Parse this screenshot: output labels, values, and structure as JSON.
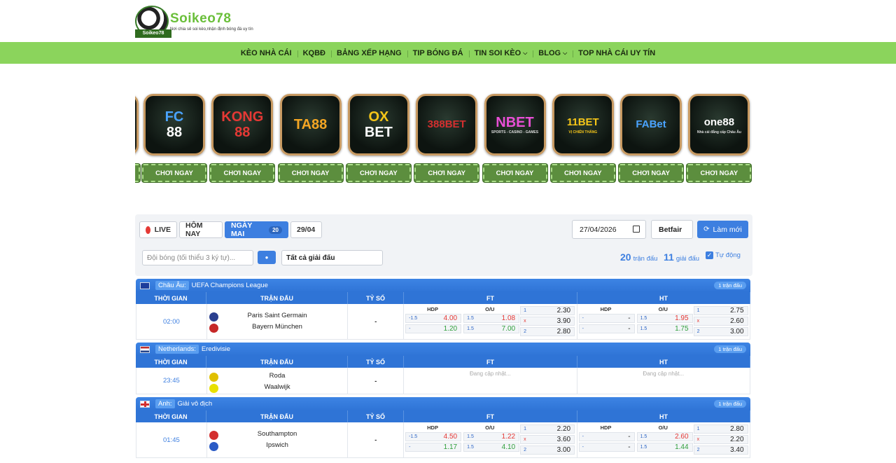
{
  "header": {
    "logo_name": "Soikeo78",
    "logo_slogan": "Nơi chia sẻ soi kèo,nhận định bóng đá uy tín",
    "logo_tag": "Soikeo78"
  },
  "nav": [
    {
      "label": "KÈO NHÀ CÁI",
      "dropdown": false
    },
    {
      "label": "KQBĐ",
      "dropdown": false
    },
    {
      "label": "BẢNG XẾP HẠNG",
      "dropdown": false
    },
    {
      "label": "TIP BÓNG ĐÁ",
      "dropdown": false
    },
    {
      "label": "TIN SOI KÈO",
      "dropdown": true
    },
    {
      "label": "BLOG",
      "dropdown": true
    },
    {
      "label": "TOP NHÀ CÁI UY TÍN",
      "dropdown": false
    }
  ],
  "casinos": [
    {
      "name": "FC88",
      "line1": "FC",
      "line2": "88",
      "color1": "#4aa3ff",
      "color2": "#ffffff"
    },
    {
      "name": "KONG88",
      "line1": "KONG",
      "line2": "88",
      "color1": "#e53935",
      "color2": "#e53935"
    },
    {
      "name": "TA88",
      "line1": "TA88",
      "line2": "",
      "color1": "#f5a623",
      "color2": "#f5a623"
    },
    {
      "name": "OXBET",
      "line1": "OX",
      "line2": "BET",
      "color1": "#f5c518",
      "color2": "#ffffff"
    },
    {
      "name": "388BET",
      "line1": "388BET",
      "line2": "",
      "color1": "#d32f2f",
      "color2": "#d32f2f"
    },
    {
      "name": "NBET",
      "line1": "NBET",
      "line2": "SPORTS - CASINO - GAMES",
      "color1": "#e94fd6",
      "color2": "#dddddd"
    },
    {
      "name": "11BET",
      "line1": "11BET",
      "line2": "VỊ CHIẾN THẮNG",
      "color1": "#f5c518",
      "color2": "#f5c518"
    },
    {
      "name": "FABET",
      "line1": "FABet",
      "line2": "",
      "color1": "#4aa3ff",
      "color2": "#4aa3ff"
    },
    {
      "name": "ONE88",
      "line1": "one88",
      "line2": "Nhà cái đẳng cấp Châu Âu",
      "color1": "#ffffff",
      "color2": "#dddddd"
    }
  ],
  "casino_button_label": "CHƠI NGAY",
  "filters": {
    "live": "LIVE",
    "today": "HÔM NAY",
    "tomorrow": "NGÀY MAI",
    "tomorrow_count": "20",
    "other_date": "29/04",
    "date_value": "27/04/2026",
    "provider": "Betfair",
    "refresh": "Làm mới",
    "search_placeholder": "Đội bóng (tối thiểu 3 ký tự)...",
    "league_select": "Tất cả giải đấu",
    "match_count": "20",
    "match_count_label": "trận đấu",
    "league_count": "11",
    "league_count_label": "giải đấu",
    "auto_label": "Tự động"
  },
  "columns": {
    "time": "THỜI GIAN",
    "match": "TRẬN ĐẤU",
    "score": "TỶ SỐ",
    "ft": "FT",
    "ht": "HT"
  },
  "odds_labels": {
    "hdp": "HDP",
    "ou": "O/U"
  },
  "pending_text": "Đang cập nhật...",
  "leagues": [
    {
      "country": "Châu Âu:",
      "name": "UEFA Champions League",
      "count": "1 trận đấu",
      "time": "02:00",
      "home": "Paris Saint Germain",
      "away": "Bayern München",
      "score": "-",
      "ft": {
        "hdp": [
          {
            "l": "-1.5",
            "v": "4.00"
          },
          {
            "l": "-",
            "v": "1.20"
          }
        ],
        "ou": [
          {
            "l": "1.5",
            "v": "1.08"
          },
          {
            "l": "1.5",
            "v": "7.00"
          }
        ],
        "x12": [
          {
            "l": "1",
            "v": "2.30"
          },
          {
            "l": "x",
            "v": "3.90"
          },
          {
            "l": "2",
            "v": "2.80"
          }
        ]
      },
      "ht": {
        "hdp": [
          {
            "l": "-",
            "v": "-"
          },
          {
            "l": "-",
            "v": "-"
          }
        ],
        "ou": [
          {
            "l": "1.5",
            "v": "1.95"
          },
          {
            "l": "1.5",
            "v": "1.75"
          }
        ],
        "x12": [
          {
            "l": "1",
            "v": "2.75"
          },
          {
            "l": "x",
            "v": "2.60"
          },
          {
            "l": "2",
            "v": "3.00"
          }
        ]
      }
    },
    {
      "country": "Netherlands:",
      "name": "Eredivisie",
      "count": "1 trận đấu",
      "time": "23:45",
      "home": "Roda",
      "away": "Waalwijk",
      "score": "-"
    },
    {
      "country": "Anh:",
      "name": "Giải vô địch",
      "count": "1 trận đấu",
      "time": "01:45",
      "home": "Southampton",
      "away": "Ipswich",
      "score": "-",
      "ft": {
        "hdp": [
          {
            "l": "-1.5",
            "v": "4.50"
          },
          {
            "l": "-",
            "v": "1.17"
          }
        ],
        "ou": [
          {
            "l": "1.5",
            "v": "1.22"
          },
          {
            "l": "1.5",
            "v": "4.10"
          }
        ],
        "x12": [
          {
            "l": "1",
            "v": "2.20"
          },
          {
            "l": "x",
            "v": "3.60"
          },
          {
            "l": "2",
            "v": "3.00"
          }
        ]
      },
      "ht": {
        "hdp": [
          {
            "l": "-",
            "v": "-"
          },
          {
            "l": "-",
            "v": "-"
          }
        ],
        "ou": [
          {
            "l": "1.5",
            "v": "2.60"
          },
          {
            "l": "1.5",
            "v": "1.44"
          }
        ],
        "x12": [
          {
            "l": "1",
            "v": "2.80"
          },
          {
            "l": "x",
            "v": "2.20"
          },
          {
            "l": "2",
            "v": "3.40"
          }
        ]
      }
    }
  ]
}
